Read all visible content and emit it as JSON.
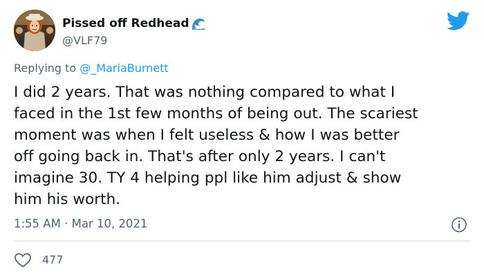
{
  "tweet": {
    "display_name": "Pissed off Redhead",
    "handle": "@VLF79",
    "replying_prefix": "Replying to ",
    "replying_to": "@_MariaBurnett",
    "text": "I did 2 years. That was nothing compared to what I\nfaced in the 1st few months of being out. The scariest\nmoment was when I felt useless & how I was better\noff going back in. That's after only 2 years. I can't\nimagine 30. TY 4 helping ppl like him adjust & show\nhim his worth.",
    "time": "1:55 AM",
    "separator": "·",
    "date": "Mar 10, 2021",
    "like_count": "477"
  },
  "icons": {
    "name_emoji": "water-wave-icon",
    "brand": "twitter-bird-icon",
    "info": "info-icon",
    "like": "heart-icon"
  },
  "colors": {
    "twitter_blue": "#1d9bf0",
    "text": "#0f1419",
    "secondary": "#536471",
    "divider": "#cfd9de"
  }
}
